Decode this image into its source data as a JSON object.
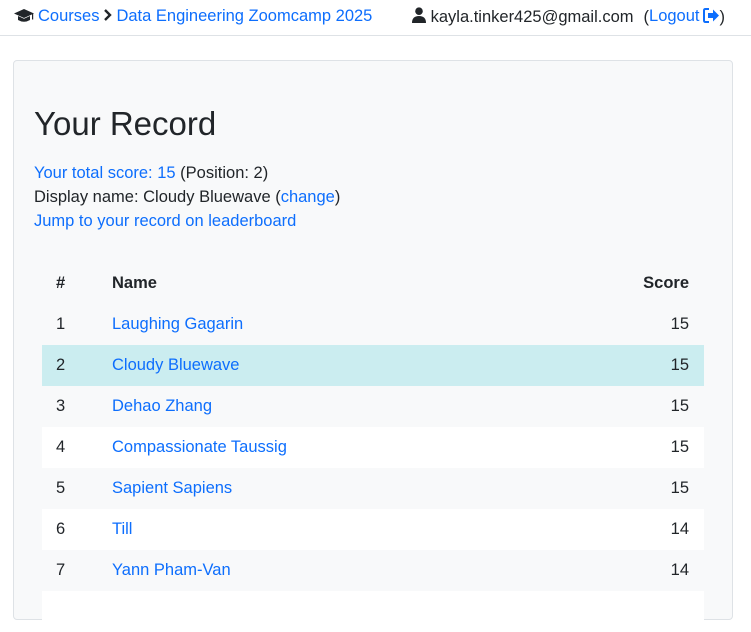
{
  "breadcrumb": {
    "courses_label": "Courses",
    "separator": ">",
    "course_label": "Data Engineering Zoomcamp 2025"
  },
  "user": {
    "email": "kayla.tinker425@gmail.com",
    "open_paren": "(",
    "logout_label": "Logout",
    "close_paren": ")"
  },
  "record": {
    "title": "Your Record",
    "total_score_label": "Your total score: 15",
    "position_text": "(Position: 2)",
    "display_name_prefix": "Display name: Cloudy Bluewave (",
    "change_label": "change",
    "display_name_suffix": ")",
    "jump_label": "Jump to your record on leaderboard"
  },
  "leaderboard": {
    "headers": {
      "rank": "#",
      "name": "Name",
      "score": "Score"
    },
    "rows": [
      {
        "rank": "1",
        "name": "Laughing Gagarin",
        "score": "15"
      },
      {
        "rank": "2",
        "name": "Cloudy Bluewave",
        "score": "15",
        "highlighted": true
      },
      {
        "rank": "3",
        "name": "Dehao Zhang",
        "score": "15"
      },
      {
        "rank": "4",
        "name": "Compassionate Taussig",
        "score": "15"
      },
      {
        "rank": "5",
        "name": "Sapient Sapiens",
        "score": "15"
      },
      {
        "rank": "6",
        "name": "Till",
        "score": "14"
      },
      {
        "rank": "7",
        "name": "Yann Pham-Van",
        "score": "14"
      }
    ]
  },
  "colors": {
    "link": "#0d6efd",
    "highlight_row": "#cbedf0",
    "card_bg": "#f8f9fa"
  },
  "icons": {
    "courses": "graduation-cap-icon",
    "user": "user-icon",
    "logout": "sign-out-icon"
  }
}
